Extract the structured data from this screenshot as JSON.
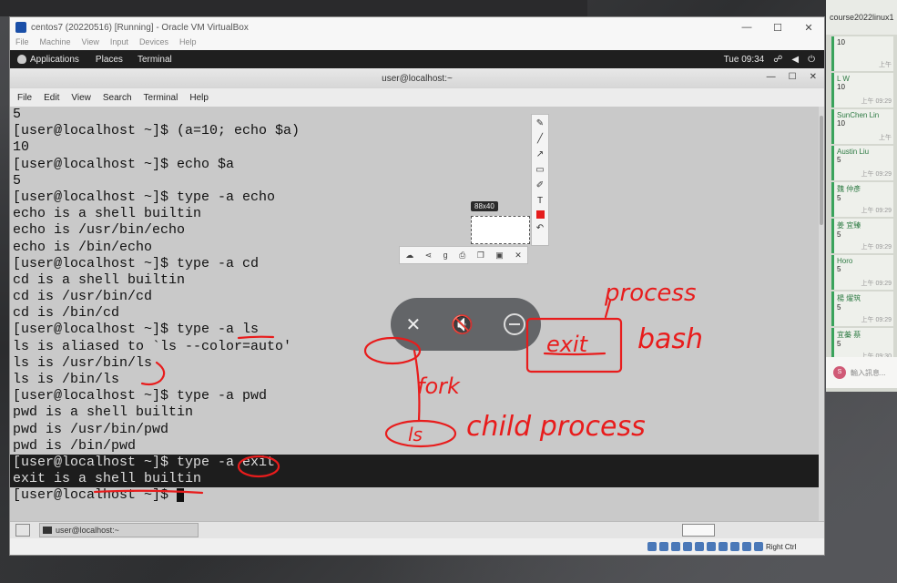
{
  "vbox": {
    "title": "centos7 (20220516) [Running] - Oracle VM VirtualBox",
    "menu": [
      "File",
      "Machine",
      "View",
      "Input",
      "Devices",
      "Help"
    ],
    "controls": [
      "—",
      "☐",
      "✕"
    ],
    "status_host_key": "Right Ctrl"
  },
  "gnome": {
    "apps": "Applications",
    "places": "Places",
    "terminal": "Terminal",
    "clock": "Tue 09:34"
  },
  "terminal": {
    "title": "user@localhost:~",
    "menu": [
      "File",
      "Edit",
      "View",
      "Search",
      "Terminal",
      "Help"
    ],
    "lines": [
      "5",
      "[user@localhost ~]$ (a=10; echo $a)",
      "10",
      "[user@localhost ~]$ echo $a",
      "5",
      "[user@localhost ~]$ type -a echo",
      "echo is a shell builtin",
      "echo is /usr/bin/echo",
      "echo is /bin/echo",
      "[user@localhost ~]$ type -a cd",
      "cd is a shell builtin",
      "cd is /usr/bin/cd",
      "cd is /bin/cd",
      "[user@localhost ~]$ type -a ls",
      "ls is aliased to `ls --color=auto'",
      "ls is /usr/bin/ls",
      "ls is /bin/ls",
      "[user@localhost ~]$ type -a pwd",
      "pwd is a shell builtin",
      "pwd is /usr/bin/pwd",
      "pwd is /bin/pwd",
      "[user@localhost ~]$ type -a exit",
      "exit is a shell builtin",
      "[user@localhost ~]$ "
    ]
  },
  "taskbar": {
    "item": "user@localhost:~"
  },
  "chat": {
    "title": "course2022linux1",
    "entries": [
      {
        "name": "",
        "count": "10",
        "time": "上午"
      },
      {
        "name": "L W",
        "count": "10",
        "time": "上午 09:29"
      },
      {
        "name": "SunChen Lin",
        "count": "10",
        "time": "上午"
      },
      {
        "name": "Austin Liu",
        "count": "5",
        "time": "上午 09:29"
      },
      {
        "name": "魏 仲彥",
        "count": "5",
        "time": "上午 09:29"
      },
      {
        "name": "姜 宜臻",
        "count": "5",
        "time": "上午 09:29"
      },
      {
        "name": "Horo",
        "count": "5",
        "time": "上午 09:29"
      },
      {
        "name": "楊 燿筑",
        "count": "5",
        "time": "上午 09:29"
      },
      {
        "name": "宜蓁 蔡",
        "count": "5",
        "time": "上午 09:30"
      }
    ],
    "input_placeholder": "輸入訊息...",
    "avatar": "S"
  },
  "screenshot_tool": {
    "size": "88x40"
  },
  "annotations": {
    "process": "process",
    "exit": "exit",
    "bash": "bash",
    "fork": "fork",
    "ls": "ls",
    "child_process": "child process"
  },
  "colors": {
    "ink": "#e81c1c",
    "terminal_bg": "#c9c9c9",
    "highlight_bg": "#1d1d1d"
  }
}
